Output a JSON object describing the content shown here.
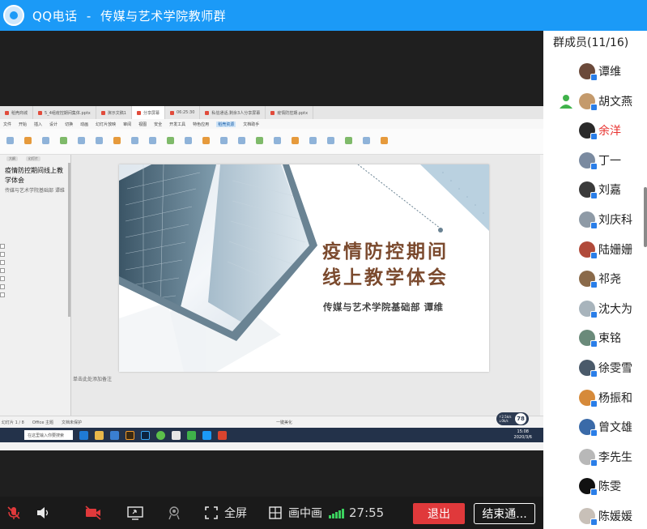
{
  "window": {
    "app_name": "QQ电话",
    "separator": "-",
    "group_name": "传媒与艺术学院教师群"
  },
  "shared_screen": {
    "tabs": [
      "稻壳商城",
      "5_4组疫控期间集体.pptx",
      "演示文稿1",
      "分享屏幕",
      "06:25:30",
      "私信通话,剩余3人分享屏幕",
      "疫情防控期.pptx"
    ],
    "menu": [
      "文件",
      "开始",
      "插入",
      "设计",
      "切换",
      "动画",
      "幻灯片放映",
      "审阅",
      "视图",
      "安全",
      "开发工具",
      "特色应用",
      "稻壳资源",
      "文档助手"
    ],
    "menu_active": "稻壳资源",
    "thumb_tabs": [
      "大纲",
      "幻灯片"
    ],
    "outline_title": "疫情防控期间线上教学体会",
    "outline_sub": "传媒与艺术学院基础部 谭维",
    "slide": {
      "title_line1": "疫情防控期间",
      "title_line2": "线上教学体会",
      "subtitle": "传媒与艺术学院基础部   谭维"
    },
    "notes_placeholder": "单击此处添加备注",
    "status": [
      "幻灯片 1 / 8",
      "Office 主题",
      "文档未保护",
      "一键美化"
    ],
    "taskbar_search": "在这里输入你要搜索",
    "clock_time": "15:08",
    "clock_date": "2020/3/6",
    "net_speed": "↑2.5k/s ↓0k/s",
    "net_pct": "78"
  },
  "members": {
    "title": "群成员(11/16)",
    "list": [
      {
        "name": "谭维",
        "color": "#6b4a3a",
        "red": false
      },
      {
        "name": "胡文燕",
        "color": "#c49a6c",
        "red": false
      },
      {
        "name": "余洋",
        "color": "#2a2a2a",
        "red": true
      },
      {
        "name": "丁一",
        "color": "#7a8aa0",
        "red": false
      },
      {
        "name": "刘嘉",
        "color": "#3a3a3a",
        "red": false
      },
      {
        "name": "刘庆科",
        "color": "#8e9aa6",
        "red": false
      },
      {
        "name": "陆姗姗",
        "color": "#b04a3a",
        "red": false
      },
      {
        "name": "祁尧",
        "color": "#8a6a4a",
        "red": false
      },
      {
        "name": "沈大为",
        "color": "#a8b4bc",
        "red": false
      },
      {
        "name": "束铭",
        "color": "#6a8a7a",
        "red": false
      },
      {
        "name": "徐雯雪",
        "color": "#4a5a6a",
        "red": false
      },
      {
        "name": "杨振和",
        "color": "#d68a3a",
        "red": false
      },
      {
        "name": "曾文雄",
        "color": "#3a6aa8",
        "red": false
      },
      {
        "name": "李先生",
        "color": "#b8b8b8",
        "red": false
      },
      {
        "name": "陈雯",
        "color": "#111111",
        "red": false
      },
      {
        "name": "陈媛媛",
        "color": "#c8c0b8",
        "red": false
      }
    ]
  },
  "controls": {
    "fullscreen": "全屏",
    "pip": "画中画",
    "duration": "27:55",
    "exit": "退出",
    "end_call": "结束通..."
  }
}
